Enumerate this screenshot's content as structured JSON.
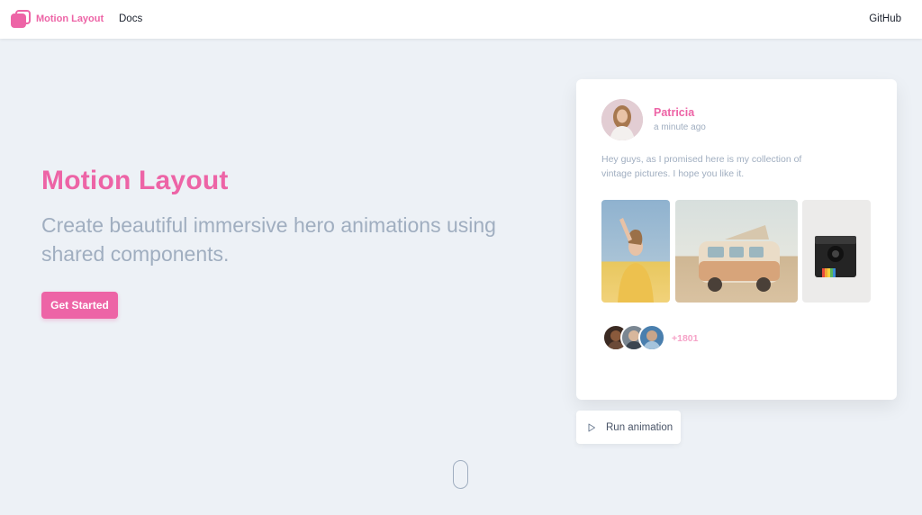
{
  "navbar": {
    "brand": "Motion Layout",
    "links": [
      "Docs"
    ],
    "github": "GitHub"
  },
  "hero": {
    "title": "Motion Layout",
    "subtitle": "Create beautiful immersive hero animations using shared components.",
    "cta": "Get Started"
  },
  "card": {
    "author": "Patricia",
    "time": "a minute ago",
    "text": "Hey guys, as I promised here is my collection of vintage pictures. I hope you like it.",
    "photos": [
      "woman-in-yellow-photo",
      "vintage-van-photo",
      "polaroid-camera-photo"
    ],
    "friends_count": "+1801"
  },
  "run_button": {
    "label": "Run animation"
  },
  "colors": {
    "accent": "#ed64a6",
    "background": "#edf1f6",
    "muted": "#a0aec0"
  },
  "icons": {
    "logo": "overlapping-squares-icon",
    "play": "play-icon",
    "scroll": "mouse-scroll-icon"
  }
}
